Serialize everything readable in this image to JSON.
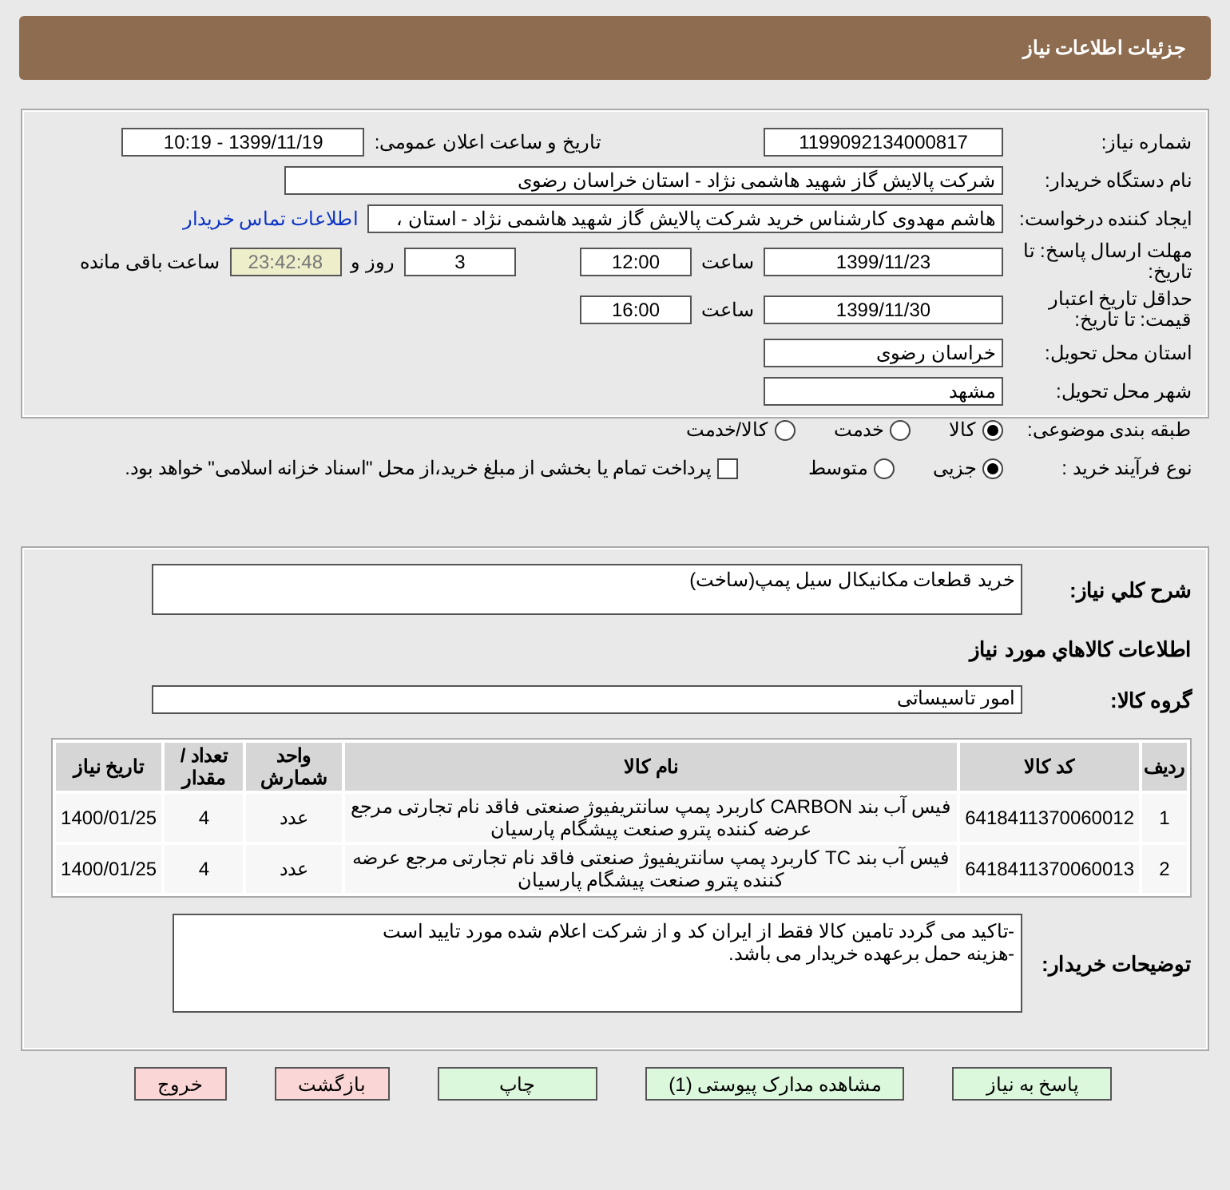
{
  "header": {
    "title": "جزئیات اطلاعات نیاز"
  },
  "details": {
    "need_number": {
      "label": "شماره نیاز:",
      "value": "1199092134000817"
    },
    "announce": {
      "label": "تاریخ و ساعت اعلان عمومی:",
      "value": "1399/11/19 - 10:19"
    },
    "buyer": {
      "label": "نام دستگاه خریدار:",
      "value": "شرکت پالایش گاز شهید هاشمی نژاد - استان خراسان رضوی"
    },
    "creator": {
      "label": "ایجاد کننده درخواست:",
      "value": "هاشم مهدوی کارشناس خرید شرکت پالایش گاز شهید هاشمی نژاد - استان ،",
      "link": "اطلاعات تماس خریدار"
    },
    "deadline": {
      "label": "مهلت ارسال پاسخ: تا تاریخ:",
      "date": "1399/11/23",
      "time_label": "ساعت",
      "time": "12:00",
      "days": "3",
      "days_label": "روز و",
      "remaining": "23:42:48",
      "remaining_label": "ساعت باقی مانده"
    },
    "validity": {
      "label": "حداقل تاریخ اعتبار قیمت: تا تاریخ:",
      "date": "1399/11/30",
      "time_label": "ساعت",
      "time": "16:00"
    },
    "province": {
      "label": "استان محل تحویل:",
      "value": "خراسان رضوی"
    },
    "city": {
      "label": "شهر محل تحویل:",
      "value": "مشهد"
    },
    "category": {
      "label": "طبقه بندی موضوعی:",
      "options": [
        {
          "label": "کالا",
          "selected": true
        },
        {
          "label": "خدمت",
          "selected": false
        },
        {
          "label": "کالا/خدمت",
          "selected": false
        }
      ]
    },
    "process": {
      "label": "نوع فرآیند خرید :",
      "options": [
        {
          "label": "جزیی",
          "selected": true
        },
        {
          "label": "متوسط",
          "selected": false
        }
      ],
      "treasury": {
        "label": "پرداخت تمام یا بخشی از مبلغ خرید،از محل \"اسناد خزانه اسلامی\" خواهد بود.",
        "checked": false
      }
    }
  },
  "description": {
    "label": "شرح كلي نياز:",
    "value": "خرید قطعات مکانیکال سیل پمپ(ساخت)"
  },
  "items_heading": "اطلاعات كالاهاي مورد نياز",
  "group": {
    "label": "گروه کالا:",
    "value": "امور تاسیساتی"
  },
  "table": {
    "columns": [
      "ردیف",
      "کد کالا",
      "نام کالا",
      "واحد شمارش",
      "تعداد / مقدار",
      "تاریخ نیاز"
    ],
    "rows": [
      [
        "1",
        "6418411370060012",
        "فیس آب بند CARBON کاربرد پمپ سانتریفیوژ صنعتی فاقد نام تجارتی مرجع عرضه کننده پترو صنعت پیشگام پارسیان",
        "عدد",
        "4",
        "1400/01/25"
      ],
      [
        "2",
        "6418411370060013",
        "فیس آب بند TC کاربرد پمپ سانتریفیوژ صنعتی فاقد نام تجارتی مرجع عرضه کننده پترو صنعت پیشگام پارسیان",
        "عدد",
        "4",
        "1400/01/25"
      ]
    ]
  },
  "buyer_notes": {
    "label": "توضیحات خریدار:",
    "lines": [
      "-تاکید می گردد تامین کالا فقط از ایران کد و از شرکت اعلام شده مورد تایید است",
      "-هزینه حمل برعهده خریدار می باشد."
    ]
  },
  "buttons": [
    {
      "label": "پاسخ به نیاز",
      "kind": "primary"
    },
    {
      "label": "مشاهده مدارک پیوستی (1)",
      "kind": "primary"
    },
    {
      "label": "چاپ",
      "kind": "primary"
    },
    {
      "label": "بازگشت",
      "kind": "danger"
    },
    {
      "label": "خروج",
      "kind": "danger"
    }
  ]
}
